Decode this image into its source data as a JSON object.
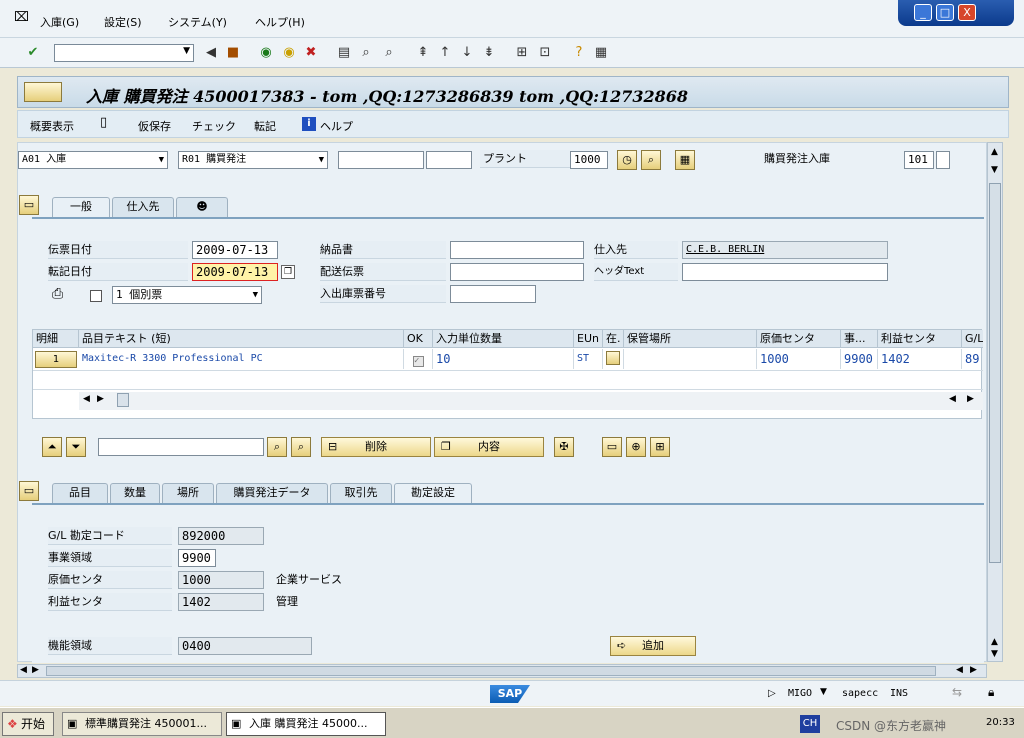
{
  "menu": {
    "items": [
      "入庫(G)",
      "設定(S)",
      "システム(Y)",
      "ヘルプ(H)"
    ]
  },
  "window_controls": {
    "minimize": "_",
    "maximize": "□",
    "close": "X"
  },
  "title": "入庫 購買発注 4500017383 - tom ,QQ:1273286839 tom ,QQ:12732868",
  "appbar": {
    "overview": "概要表示",
    "hold": "仮保存",
    "check": "チェック",
    "post": "転記",
    "help": "ヘルプ"
  },
  "header": {
    "action": "A01 入庫",
    "reference": "R01 購買発注",
    "plant_label": "プラント",
    "plant_value": "1000",
    "movement_label": "購買発注入庫",
    "movement_value": "101"
  },
  "general_tabs": [
    "一般",
    "仕入先"
  ],
  "general": {
    "doc_date_label": "伝票日付",
    "doc_date": "2009-07-13",
    "post_date_label": "転記日付",
    "post_date": "2009-07-13",
    "print_option": "1 個別票",
    "delivery_note_label": "納品書",
    "bill_of_lading_label": "配送伝票",
    "gr_slip_label": "入出庫票番号",
    "vendor_label": "仕入先",
    "vendor_value": "C.E.B. BERLIN",
    "header_text_label": "ヘッダText"
  },
  "table": {
    "columns": [
      "明細",
      "品目テキスト (短)",
      "OK",
      "入力単位数量",
      "EUn",
      "在.",
      "保管場所",
      "原価センタ",
      "事...",
      "利益センタ",
      "G/L"
    ],
    "row": {
      "line": "1",
      "material": "Maxitec-R 3300 Professional PC",
      "qty": "10",
      "unit": "ST",
      "cost_center": "1000",
      "business_area": "9900",
      "profit_center": "1402",
      "gl": "89"
    }
  },
  "table_buttons": {
    "delete": "削除",
    "content": "内容"
  },
  "detail_tabs": [
    "品目",
    "数量",
    "場所",
    "購買発注データ",
    "取引先",
    "勘定設定"
  ],
  "detail": {
    "gl_label": "G/L 勘定コード",
    "gl_value": "892000",
    "ba_label": "事業領域",
    "ba_value": "9900",
    "cc_label": "原価センタ",
    "cc_value": "1000",
    "cc_desc": "企業サービス",
    "pc_label": "利益センタ",
    "pc_value": "1402",
    "pc_desc": "管理",
    "fa_label": "機能領域",
    "fa_value": "0400",
    "add_button": "追加"
  },
  "status": {
    "sap_logo": "SAP",
    "transaction": "MIGO",
    "server": "sapecc",
    "mode": "INS"
  },
  "taskbar": {
    "start": "开始",
    "task1": "標準購買発注 450001...",
    "task2": "入庫 購買発注 45000...",
    "lang": "CH",
    "watermark": "CSDN @东方老赢神",
    "time": "20:33"
  }
}
